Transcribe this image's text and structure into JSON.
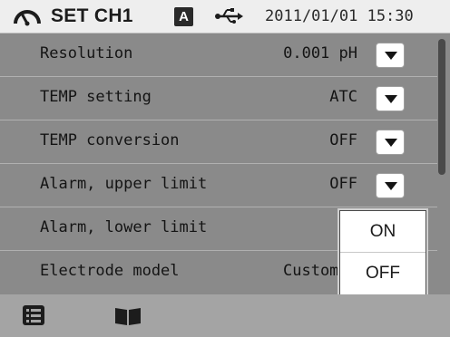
{
  "header": {
    "title": "SET CH1",
    "mode_badge": "A",
    "datetime": "2011/01/01 15:30",
    "icons": [
      "gauge-icon",
      "usb-icon"
    ]
  },
  "settings": [
    {
      "label": "Resolution",
      "value": "0.001 pH",
      "has_dropdown": true
    },
    {
      "label": "TEMP setting",
      "value": "ATC",
      "has_dropdown": true
    },
    {
      "label": "TEMP conversion",
      "value": "OFF",
      "has_dropdown": true
    },
    {
      "label": "Alarm, upper limit",
      "value": "OFF",
      "has_dropdown": true
    },
    {
      "label": "Alarm, lower limit",
      "value": "",
      "has_dropdown": false
    },
    {
      "label": "Electrode model",
      "value": "Custom",
      "has_dropdown": false
    }
  ],
  "popup": {
    "options": [
      "ON",
      "OFF"
    ]
  },
  "footer": {
    "icons": [
      "menu-list-icon",
      "book-icon"
    ]
  },
  "colors": {
    "list_background": "#8a8a8a",
    "header_background": "#eeeeee",
    "footer_background": "#a4a4a4"
  }
}
